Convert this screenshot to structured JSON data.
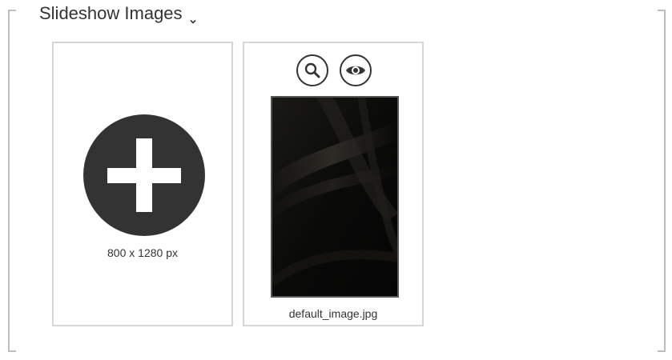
{
  "section": {
    "title": "Slideshow Images",
    "expand_icon": "chevron-down-icon"
  },
  "add_card": {
    "icon": "plus-circle-icon",
    "dimensions": "800 x 1280 px"
  },
  "image_card": {
    "actions": [
      {
        "icon": "search-icon",
        "label": "Zoom"
      },
      {
        "icon": "eye-icon",
        "label": "Preview"
      }
    ],
    "filename": "default_image.jpg"
  },
  "colors": {
    "plus_circle": "#333333",
    "border": "#d6d6d6",
    "text": "#333333"
  }
}
